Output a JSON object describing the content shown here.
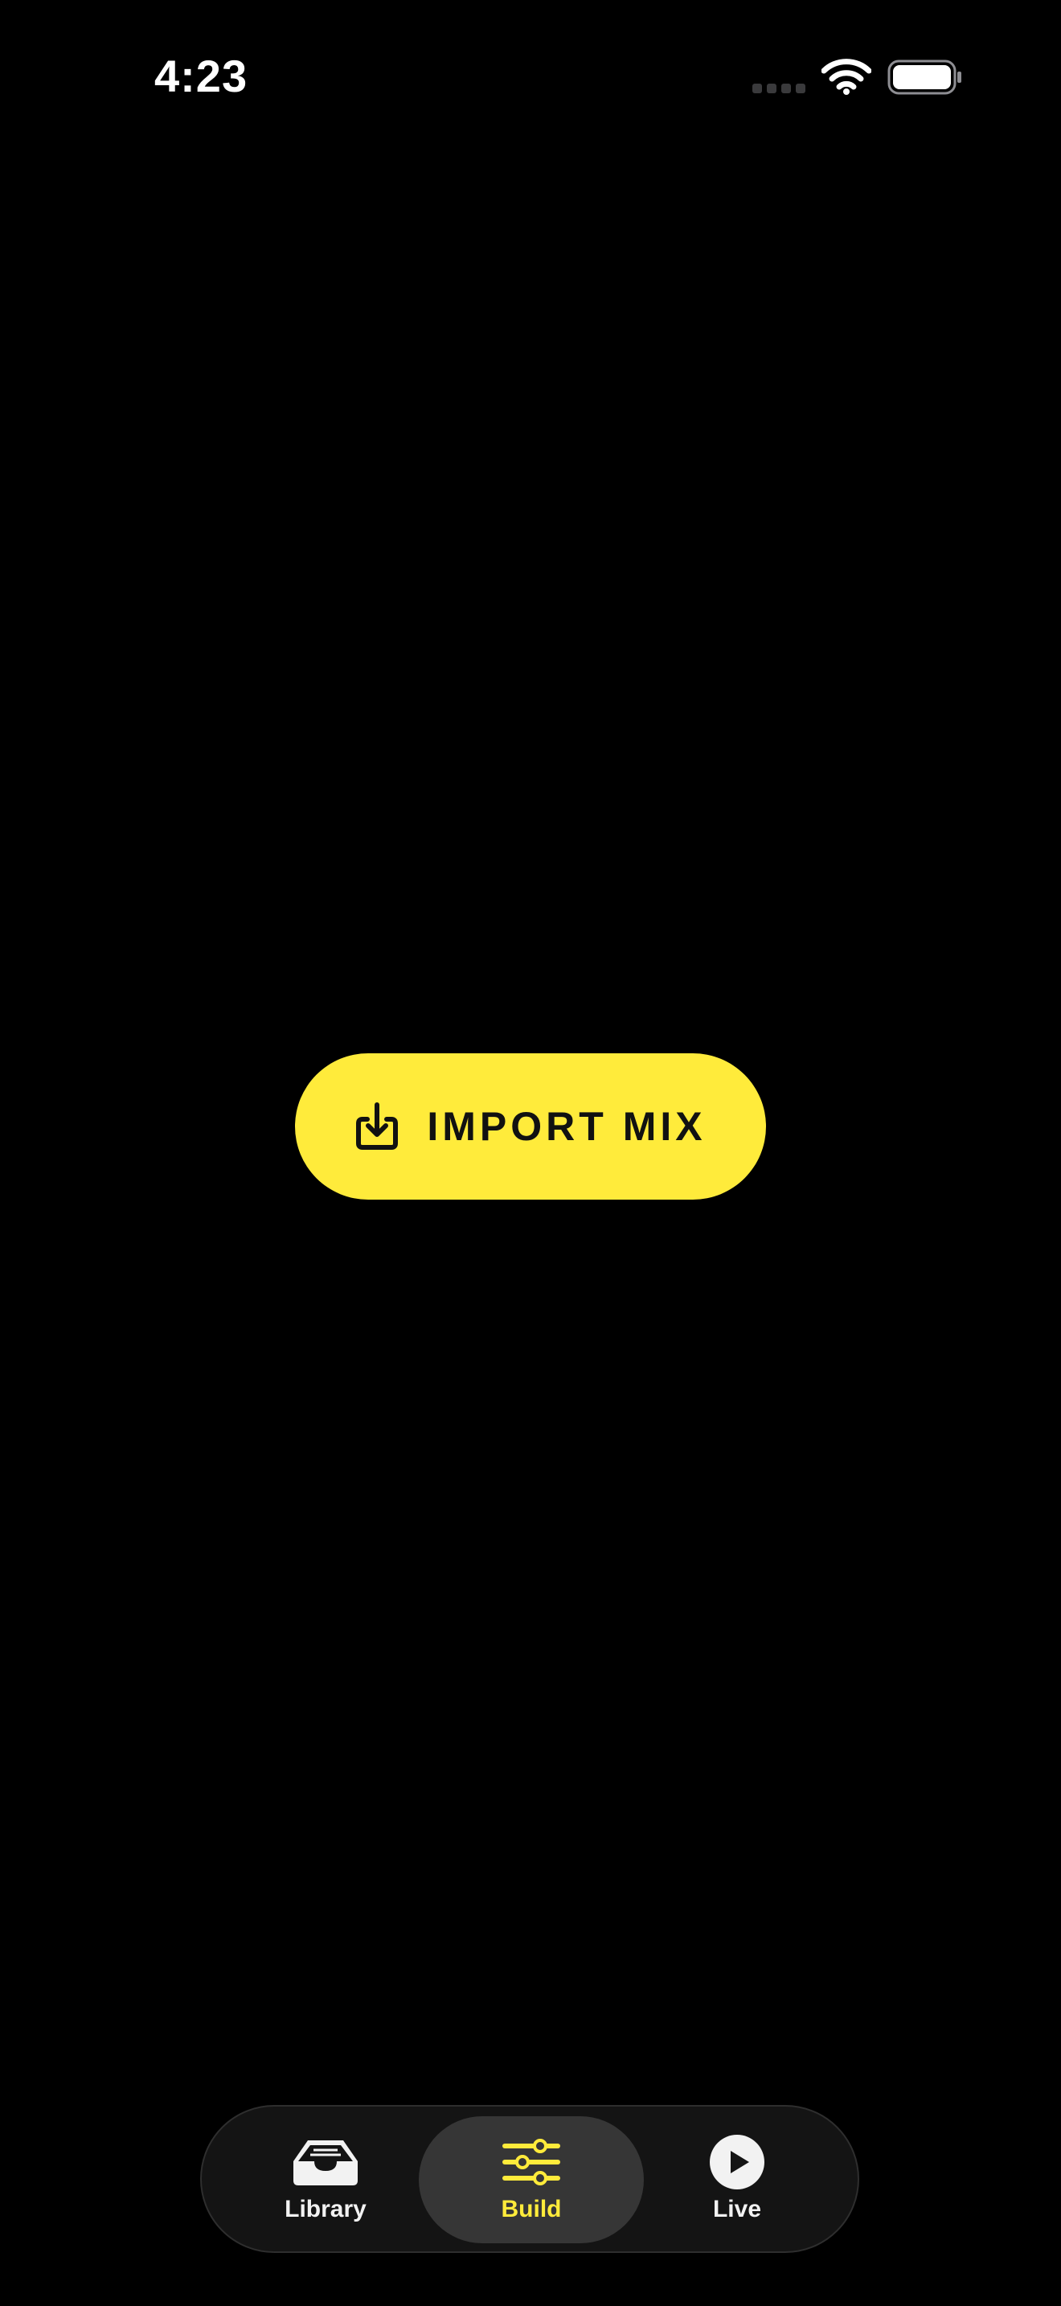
{
  "status_bar": {
    "time": "4:23",
    "icons": [
      "cell-signal-icon",
      "wifi-icon",
      "battery-icon"
    ]
  },
  "main": {
    "import_button": {
      "label": "IMPORT MIX",
      "icon": "import-download-icon"
    }
  },
  "tab_bar": {
    "selected": "Build",
    "tabs": [
      {
        "label": "Library",
        "icon": "tray-icon"
      },
      {
        "label": "Build",
        "icon": "sliders-icon"
      },
      {
        "label": "Live",
        "icon": "play-circle-icon"
      }
    ]
  },
  "colors": {
    "background": "#000000",
    "accent": "#ffeb3b",
    "tab_bar_background": "#141414",
    "tab_selected_background": "#363636",
    "tab_label": "#f2f2f2"
  }
}
